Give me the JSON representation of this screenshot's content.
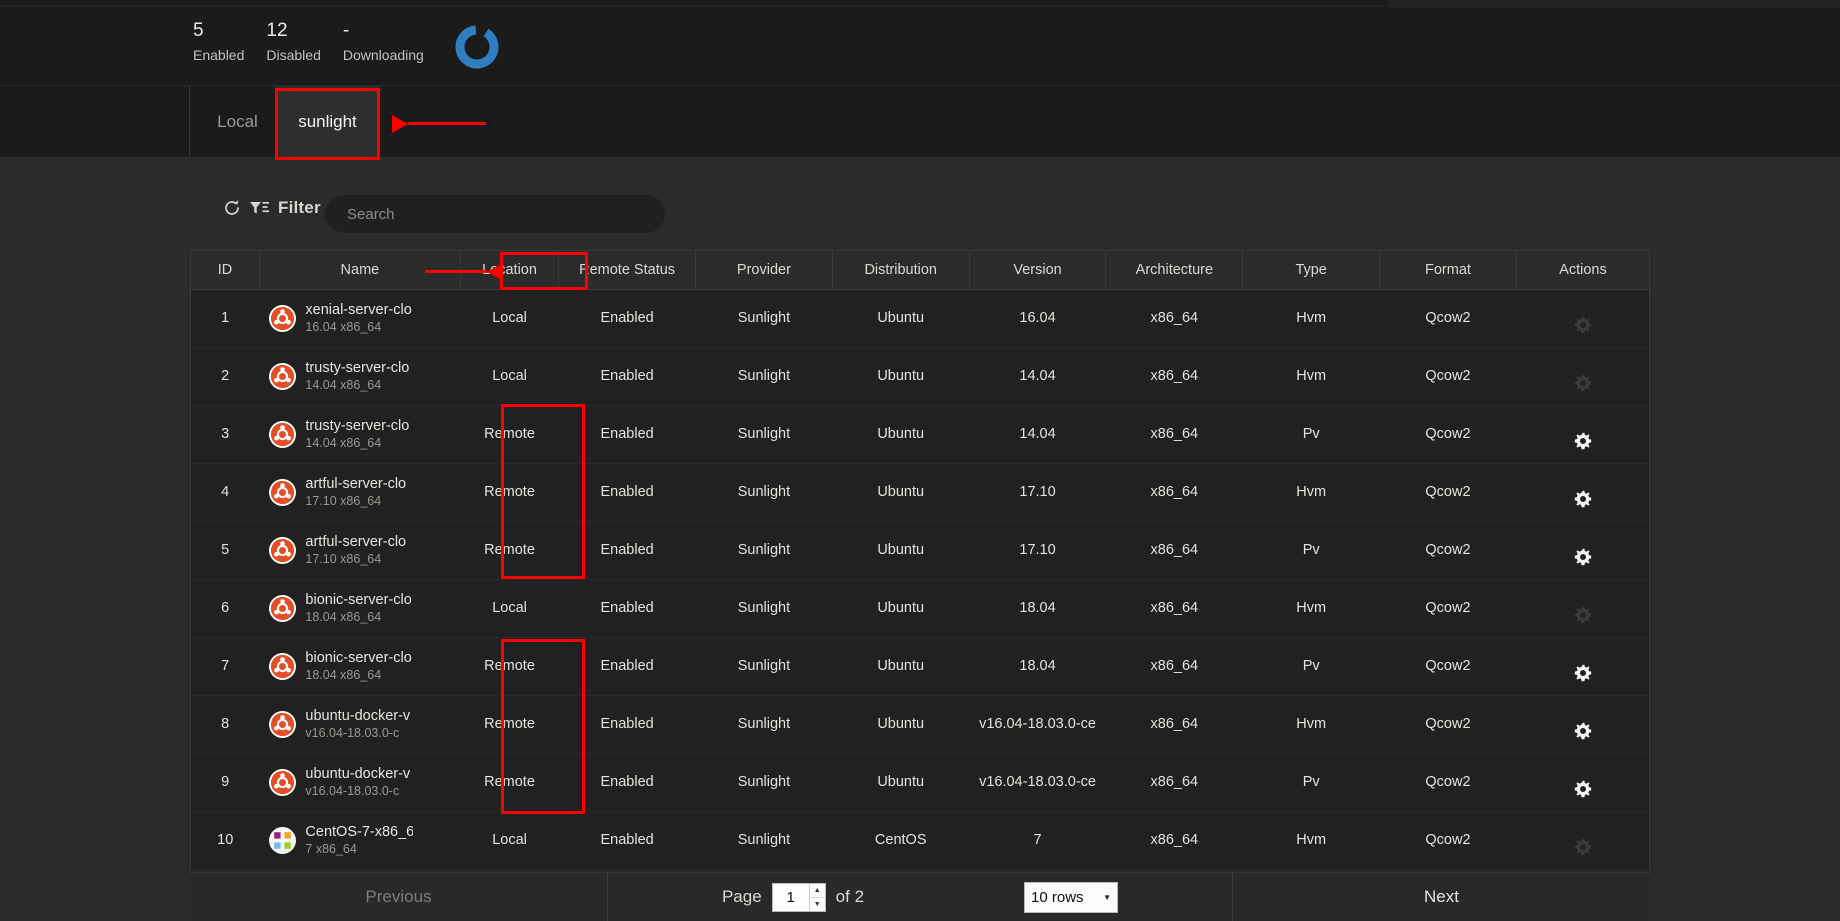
{
  "header": {
    "stats": [
      {
        "value": "5",
        "label": "Enabled"
      },
      {
        "value": "12",
        "label": "Disabled"
      },
      {
        "value": "-",
        "label": "Downloading"
      }
    ],
    "chart_icon": "donut-chart-icon",
    "donut_color": "#2f7fc0"
  },
  "tabs": [
    {
      "label": "Local",
      "active": false
    },
    {
      "label": "sunlight",
      "active": true
    }
  ],
  "toolbar": {
    "refresh_icon": "refresh-icon",
    "funnel_icon": "funnel-filter-icon",
    "filter_label": "Filter",
    "search_placeholder": "Search",
    "search_value": ""
  },
  "table": {
    "columns": [
      "ID",
      "Name",
      "Location",
      "Remote Status",
      "Provider",
      "Distribution",
      "Version",
      "Architecture",
      "Type",
      "Format",
      "Actions"
    ],
    "rows": [
      {
        "id": "1",
        "name": "xenial-server-clo",
        "name_sub": "16.04 x86_64",
        "icon": "ubuntu-logo-icon",
        "location": "Local",
        "remote_status": "Enabled",
        "provider": "Sunlight",
        "distribution": "Ubuntu",
        "version": "16.04",
        "architecture": "x86_64",
        "type": "Hvm",
        "format": "Qcow2",
        "action_enabled": false
      },
      {
        "id": "2",
        "name": "trusty-server-clo",
        "name_sub": "14.04 x86_64",
        "icon": "ubuntu-logo-icon",
        "location": "Local",
        "remote_status": "Enabled",
        "provider": "Sunlight",
        "distribution": "Ubuntu",
        "version": "14.04",
        "architecture": "x86_64",
        "type": "Hvm",
        "format": "Qcow2",
        "action_enabled": false
      },
      {
        "id": "3",
        "name": "trusty-server-clo",
        "name_sub": "14.04 x86_64",
        "icon": "ubuntu-logo-icon",
        "location": "Remote",
        "remote_status": "Enabled",
        "provider": "Sunlight",
        "distribution": "Ubuntu",
        "version": "14.04",
        "architecture": "x86_64",
        "type": "Pv",
        "format": "Qcow2",
        "action_enabled": true
      },
      {
        "id": "4",
        "name": "artful-server-clo",
        "name_sub": "17.10 x86_64",
        "icon": "ubuntu-logo-icon",
        "location": "Remote",
        "remote_status": "Enabled",
        "provider": "Sunlight",
        "distribution": "Ubuntu",
        "version": "17.10",
        "architecture": "x86_64",
        "type": "Hvm",
        "format": "Qcow2",
        "action_enabled": true
      },
      {
        "id": "5",
        "name": "artful-server-clo",
        "name_sub": "17.10 x86_64",
        "icon": "ubuntu-logo-icon",
        "location": "Remote",
        "remote_status": "Enabled",
        "provider": "Sunlight",
        "distribution": "Ubuntu",
        "version": "17.10",
        "architecture": "x86_64",
        "type": "Pv",
        "format": "Qcow2",
        "action_enabled": true
      },
      {
        "id": "6",
        "name": "bionic-server-clo",
        "name_sub": "18.04 x86_64",
        "icon": "ubuntu-logo-icon",
        "location": "Local",
        "remote_status": "Enabled",
        "provider": "Sunlight",
        "distribution": "Ubuntu",
        "version": "18.04",
        "architecture": "x86_64",
        "type": "Hvm",
        "format": "Qcow2",
        "action_enabled": false
      },
      {
        "id": "7",
        "name": "bionic-server-clo",
        "name_sub": "18.04 x86_64",
        "icon": "ubuntu-logo-icon",
        "location": "Remote",
        "remote_status": "Enabled",
        "provider": "Sunlight",
        "distribution": "Ubuntu",
        "version": "18.04",
        "architecture": "x86_64",
        "type": "Pv",
        "format": "Qcow2",
        "action_enabled": true
      },
      {
        "id": "8",
        "name": "ubuntu-docker-v",
        "name_sub": "v16.04-18.03.0-c",
        "icon": "ubuntu-logo-icon",
        "location": "Remote",
        "remote_status": "Enabled",
        "provider": "Sunlight",
        "distribution": "Ubuntu",
        "version": "v16.04-18.03.0-ce",
        "architecture": "x86_64",
        "type": "Hvm",
        "format": "Qcow2",
        "action_enabled": true
      },
      {
        "id": "9",
        "name": "ubuntu-docker-v",
        "name_sub": "v16.04-18.03.0-c",
        "icon": "ubuntu-logo-icon",
        "location": "Remote",
        "remote_status": "Enabled",
        "provider": "Sunlight",
        "distribution": "Ubuntu",
        "version": "v16.04-18.03.0-ce",
        "architecture": "x86_64",
        "type": "Pv",
        "format": "Qcow2",
        "action_enabled": true
      },
      {
        "id": "10",
        "name": "CentOS-7-x86_6",
        "name_sub": "7 x86_64",
        "icon": "centos-logo-icon",
        "location": "Local",
        "remote_status": "Enabled",
        "provider": "Sunlight",
        "distribution": "CentOS",
        "version": "7",
        "architecture": "x86_64",
        "type": "Hvm",
        "format": "Qcow2",
        "action_enabled": false
      }
    ]
  },
  "pager": {
    "previous_label": "Previous",
    "page_label": "Page",
    "page_value": "1",
    "of_label": "of 2",
    "rows_per_page": "10 rows",
    "next_label": "Next"
  },
  "annotations": {
    "color": "#ff0000",
    "items": [
      "sunlight-tab-highlight",
      "location-header-highlight",
      "remote-cells-highlight-a",
      "remote-cells-highlight-b"
    ]
  }
}
